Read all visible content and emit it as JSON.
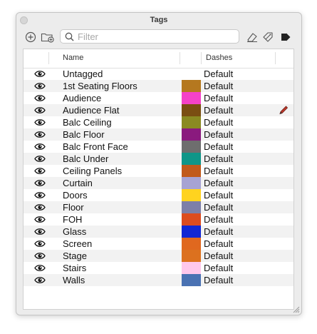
{
  "window": {
    "title": "Tags"
  },
  "search": {
    "placeholder": "Filter",
    "value": ""
  },
  "toolbar": {
    "add_tag_icon": "plus-circle-icon",
    "add_folder_icon": "folder-plus-icon",
    "purge_icon": "eraser-icon",
    "tag_icon": "tags-icon",
    "details_icon": "details-arrow-icon"
  },
  "columns": {
    "name": "Name",
    "dashes": "Dashes"
  },
  "tags": [
    {
      "name": "Untagged",
      "color": null,
      "dashes": "Default",
      "active": false
    },
    {
      "name": "1st Seating Floors",
      "color": "#b5781f",
      "dashes": "Default",
      "active": false
    },
    {
      "name": "Audience",
      "color": "#f542c8",
      "dashes": "Default",
      "active": false
    },
    {
      "name": "Audience Flat",
      "color": "#7a4e12",
      "dashes": "Default",
      "active": true
    },
    {
      "name": "Balc Ceiling",
      "color": "#8a8a22",
      "dashes": "Default",
      "active": false
    },
    {
      "name": "Balc Floor",
      "color": "#8a1a7e",
      "dashes": "Default",
      "active": false
    },
    {
      "name": "Balc Front Face",
      "color": "#6e6e6e",
      "dashes": "Default",
      "active": false
    },
    {
      "name": "Balc Under",
      "color": "#0f9688",
      "dashes": "Default",
      "active": false
    },
    {
      "name": "Ceiling Panels",
      "color": "#c15a1b",
      "dashes": "Default",
      "active": false
    },
    {
      "name": "Curtain",
      "color": "#a7a3d3",
      "dashes": "Default",
      "active": false
    },
    {
      "name": "Doors",
      "color": "#ffd31f",
      "dashes": "Default",
      "active": false
    },
    {
      "name": "Floor",
      "color": "#7d7fa8",
      "dashes": "Default",
      "active": false
    },
    {
      "name": "FOH",
      "color": "#dd4c1f",
      "dashes": "Default",
      "active": false
    },
    {
      "name": "Glass",
      "color": "#1227d4",
      "dashes": "Default",
      "active": false
    },
    {
      "name": "Screen",
      "color": "#e0681f",
      "dashes": "Default",
      "active": false
    },
    {
      "name": "Stage",
      "color": "#dc711f",
      "dashes": "Default",
      "active": false
    },
    {
      "name": "Stairs",
      "color": "#ffc8ec",
      "dashes": "Default",
      "active": false
    },
    {
      "name": "Walls",
      "color": "#4a72b3",
      "dashes": "Default",
      "active": false
    }
  ],
  "icons": {
    "visibility": "eye-icon",
    "active_tag": "pencil-icon",
    "resize": "resize-grip-icon"
  }
}
